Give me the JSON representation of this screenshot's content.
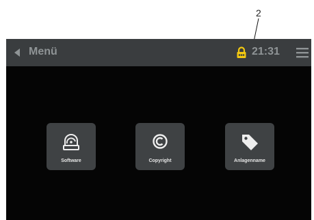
{
  "callout": {
    "number": "2"
  },
  "topbar": {
    "title": "Menü",
    "time": "21:31",
    "back_icon": "chevron-left-icon",
    "lock_icon": "lock-icon",
    "menu_icon": "hamburger-icon"
  },
  "tiles": [
    {
      "label": "Software",
      "icon": "software-icon"
    },
    {
      "label": "Copyright",
      "icon": "copyright-icon"
    },
    {
      "label": "Anlagenname",
      "icon": "tag-icon"
    }
  ],
  "colors": {
    "background": "#050505",
    "topbar": "#3a3d3f",
    "tile": "#3f4244",
    "text": "#8f9496",
    "icon": "#eeeeee",
    "lock_accent": "#f2c811"
  }
}
